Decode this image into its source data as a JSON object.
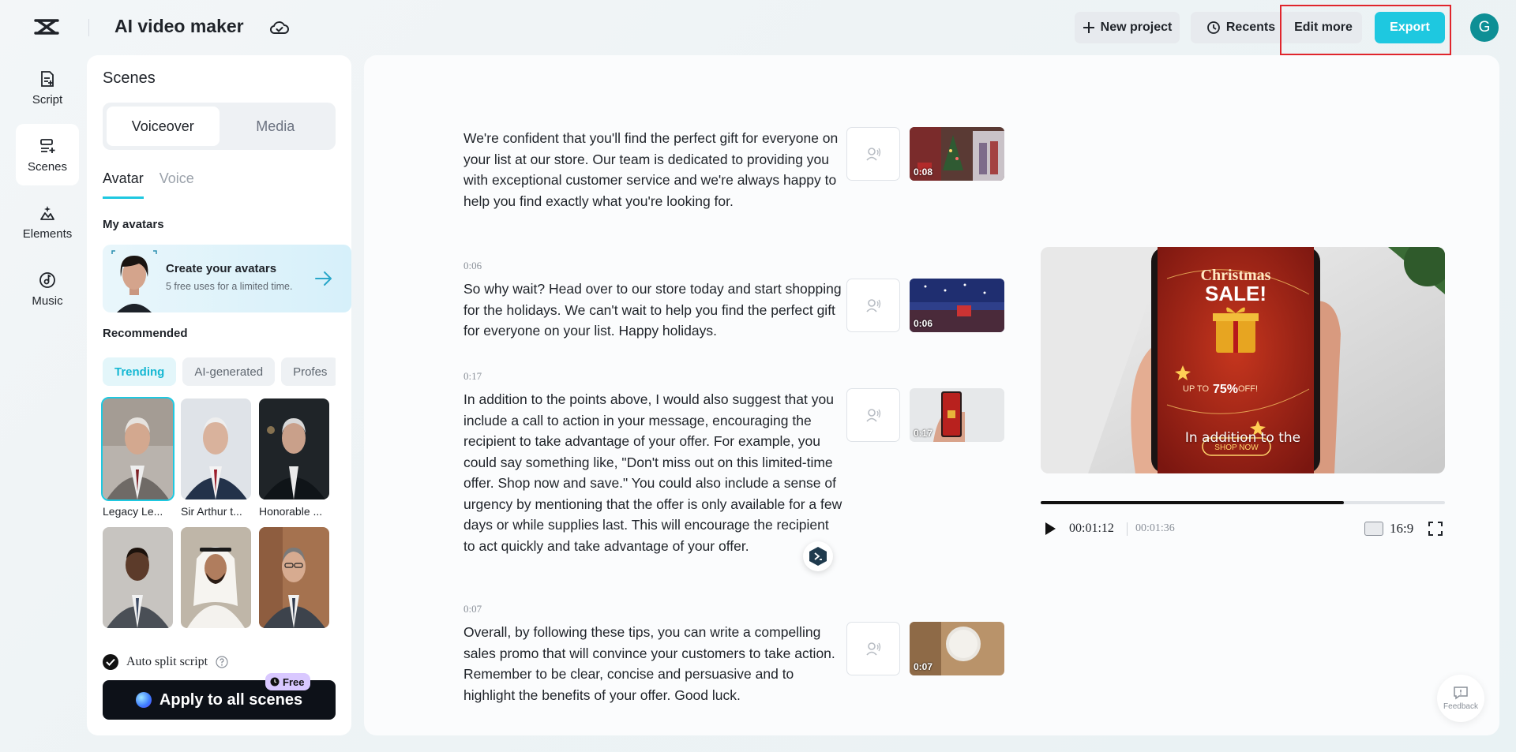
{
  "header": {
    "app_title": "AI video maker",
    "new_project": "New project",
    "recents": "Recents",
    "edit_more": "Edit more",
    "export": "Export",
    "user_initial": "G"
  },
  "rail": {
    "items": [
      {
        "label": "Script",
        "icon": "script-icon"
      },
      {
        "label": "Scenes",
        "icon": "scenes-icon"
      },
      {
        "label": "Elements",
        "icon": "elements-icon"
      },
      {
        "label": "Music",
        "icon": "music-icon"
      }
    ],
    "active": "Scenes"
  },
  "scenes_panel": {
    "title": "Scenes",
    "segments": [
      "Voiceover",
      "Media"
    ],
    "subtabs": [
      "Avatar",
      "Voice"
    ],
    "my_avatars_label": "My avatars",
    "create_card": {
      "title": "Create your avatars",
      "subtitle": "5 free uses for a limited time."
    },
    "recommended_label": "Recommended",
    "chips": [
      "Trending",
      "AI-generated",
      "Profes"
    ],
    "avatars": [
      {
        "name": "Legacy Le..."
      },
      {
        "name": "Sir Arthur t..."
      },
      {
        "name": "Honorable ..."
      },
      {
        "name": ""
      },
      {
        "name": ""
      },
      {
        "name": ""
      }
    ],
    "auto_split": "Auto split script",
    "apply_button": "Apply to all scenes",
    "free_badge": "Free"
  },
  "scenes": [
    {
      "time": "",
      "text": "We're confident that you'll find the perfect gift for everyone on your list at our store. Our team is dedicated to providing you with exceptional customer service and we're always happy to help you find exactly what you're looking for.",
      "thumb_time": "0:08"
    },
    {
      "time": "0:06",
      "text": "So why wait? Head over to our store today and start shopping for the holidays. We can't wait to help you find the perfect gift for everyone on your list. Happy holidays.",
      "thumb_time": "0:06"
    },
    {
      "time": "0:17",
      "text": "In addition to the points above, I would also suggest that you include a call to action in your message, encouraging the recipient to take advantage of your offer. For example, you could say something like, \"Don't miss out on this limited-time offer. Shop now and save.\" You could also include a sense of urgency by mentioning that the offer is only available for a few days or while supplies last. This will encourage the recipient to act quickly and take advantage of your offer.",
      "thumb_time": "0:17"
    },
    {
      "time": "0:07",
      "text": "Overall, by following these tips, you can write a compelling sales promo that will convince your customers to take action. Remember to be clear, concise and persuasive and to highlight the benefits of your offer. Good luck.",
      "thumb_time": "0:07"
    }
  ],
  "preview": {
    "phone_headline_1": "Christmas",
    "phone_headline_2": "SALE!",
    "phone_offer_prefix": "UP TO",
    "phone_offer_value": "75%",
    "phone_offer_suffix": "OFF!",
    "phone_button": "SHOP NOW",
    "caption": "In addition to the",
    "current_time": "00:01:12",
    "total_time": "00:01:36",
    "progress": 0.75,
    "aspect_ratio": "16:9"
  },
  "feedback_label": "Feedback",
  "colors": {
    "accent": "#1ec8e0",
    "highlight": "#e0252c",
    "user_avatar": "#0e8f95"
  }
}
